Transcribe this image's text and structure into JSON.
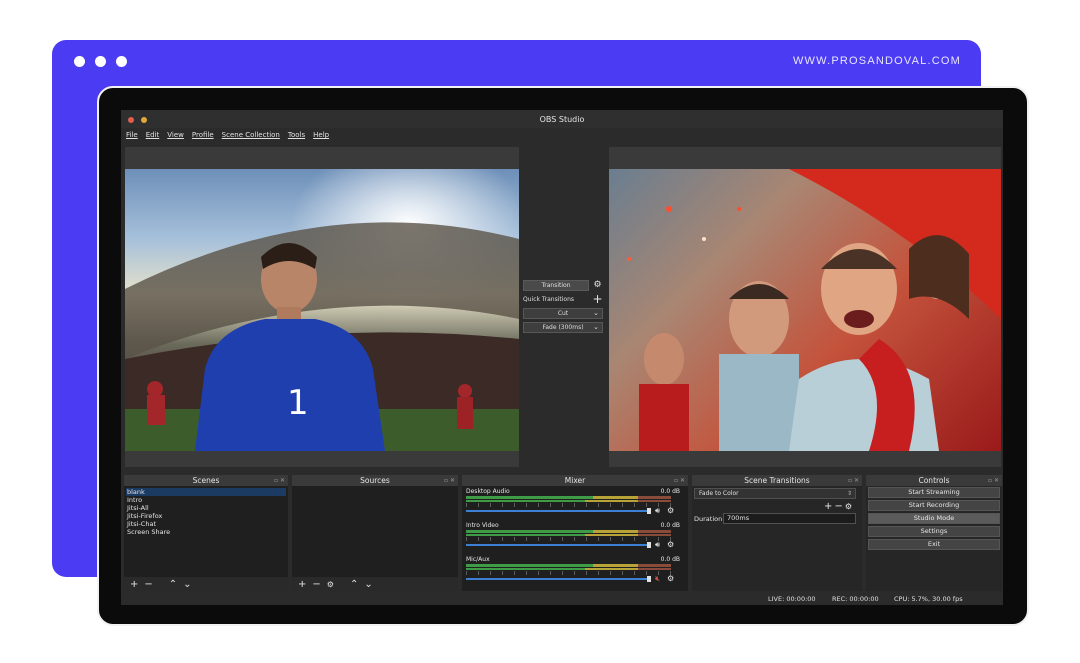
{
  "backdrop": {
    "url": "WWW.PROSANDOVAL.COM",
    "accent": "#4b3bf2"
  },
  "window": {
    "title": "OBS Studio"
  },
  "menu": [
    "File",
    "Edit",
    "View",
    "Profile",
    "Scene Collection",
    "Tools",
    "Help"
  ],
  "transitions_mid": {
    "transition_label": "Transition",
    "quick_label": "Quick Transitions",
    "cut_label": "Cut",
    "fade_label": "Fade (300ms)"
  },
  "docks": {
    "scenes": "Scenes",
    "sources": "Sources",
    "mixer": "Mixer",
    "scene_transitions": "Scene Transitions",
    "controls": "Controls"
  },
  "scenes": [
    "blank",
    "Intro",
    "Jitsi-All",
    "Jitsi-Firefox",
    "Jitsi-Chat",
    "Screen Share"
  ],
  "mixer": [
    {
      "name": "Desktop Audio",
      "db": "0.0 dB",
      "muted": false
    },
    {
      "name": "Intro Video",
      "db": "0.0 dB",
      "muted": false
    },
    {
      "name": "Mic/Aux",
      "db": "0.0 dB",
      "muted": true
    }
  ],
  "scene_transitions": {
    "selected": "Fade to Color",
    "duration_label": "Duration",
    "duration_value": "700ms"
  },
  "controls": [
    "Start Streaming",
    "Start Recording",
    "Studio Mode",
    "Settings",
    "Exit"
  ],
  "status": {
    "live": "LIVE: 00:00:00",
    "rec": "REC: 00:00:00",
    "cpu": "CPU: 5.7%, 30.00 fps"
  }
}
